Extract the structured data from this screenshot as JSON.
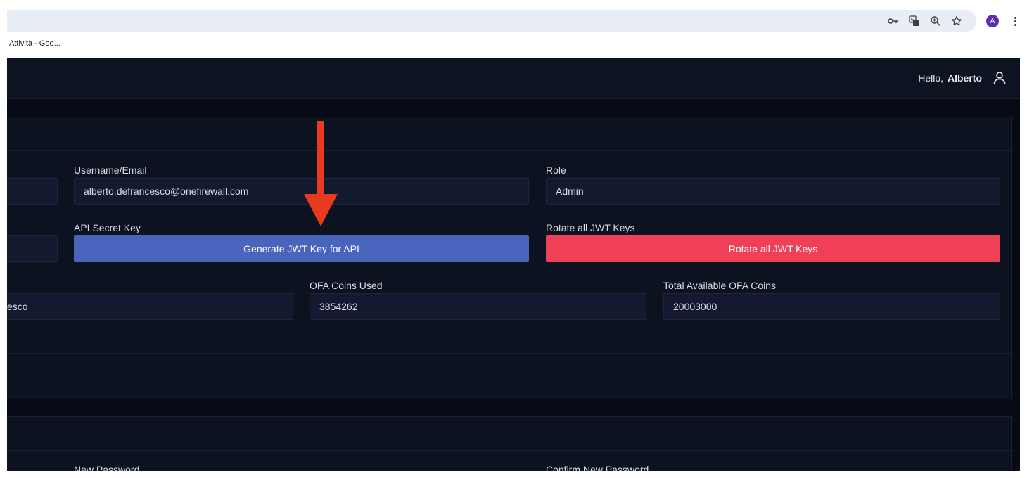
{
  "browser": {
    "bookmark_label": "Attività - Goo...",
    "avatar_letter": "A",
    "icons": [
      "key-icon",
      "translate-icon",
      "zoom-icon",
      "star-icon",
      "more-icon"
    ]
  },
  "header": {
    "hello_prefix": "Hello,",
    "user_name": "Alberto"
  },
  "account": {
    "username_label": "Username/Email",
    "username_value": "alberto.defrancesco@onefirewall.com",
    "role_label": "Role",
    "role_value": "Admin",
    "api_key_label": "API Secret Key",
    "generate_button": "Generate JWT Key for API",
    "rotate_label": "Rotate all JWT Keys",
    "rotate_button": "Rotate all JWT Keys",
    "partial_name_value": "esco",
    "coins_used_label": "OFA Coins Used",
    "coins_used_value": "3854262",
    "coins_available_label": "Total Available OFA Coins",
    "coins_available_value": "20003000"
  },
  "password": {
    "new_label": "New Password",
    "confirm_label": "Confirm New Password"
  },
  "colors": {
    "background": "#080b16",
    "primary_button": "#4864bd",
    "danger_button": "#ef4058",
    "annotation_arrow": "#e83a1f"
  }
}
